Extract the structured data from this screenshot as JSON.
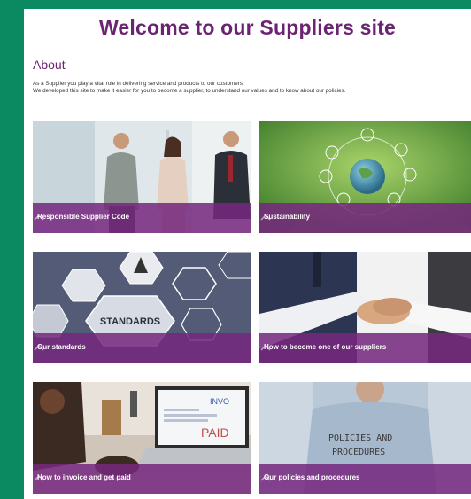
{
  "header": {
    "title": "Welcome to our Suppliers site"
  },
  "about": {
    "heading": "About",
    "line1": "As a Supplier you play a vital role in delivering service and products to our customers.",
    "line2": "We developed this site to make it easier for you to become a supplier, to understand our values and to know about our policies."
  },
  "tiles": [
    {
      "label": "Responsible Supplier Code",
      "icon": "chevron-up-icon"
    },
    {
      "label": "Sustainability",
      "icon": "chevron-up-icon"
    },
    {
      "label": "Our standards",
      "icon": "chevron-up-icon",
      "image_text": "STANDARDS"
    },
    {
      "label": "How to become one of our suppliers",
      "icon": "chevron-up-icon"
    },
    {
      "label": "How to invoice and get paid",
      "icon": "chevron-up-icon",
      "image_text_1": "INVO",
      "image_text_2": "PAID"
    },
    {
      "label": "Our policies and procedures",
      "icon": "chevron-up-icon",
      "image_text_1": "POLICIES AND",
      "image_text_2": "PROCEDURES"
    }
  ],
  "colors": {
    "accent": "#6b2472",
    "frame": "#0b8a62",
    "band": "#76287e"
  }
}
